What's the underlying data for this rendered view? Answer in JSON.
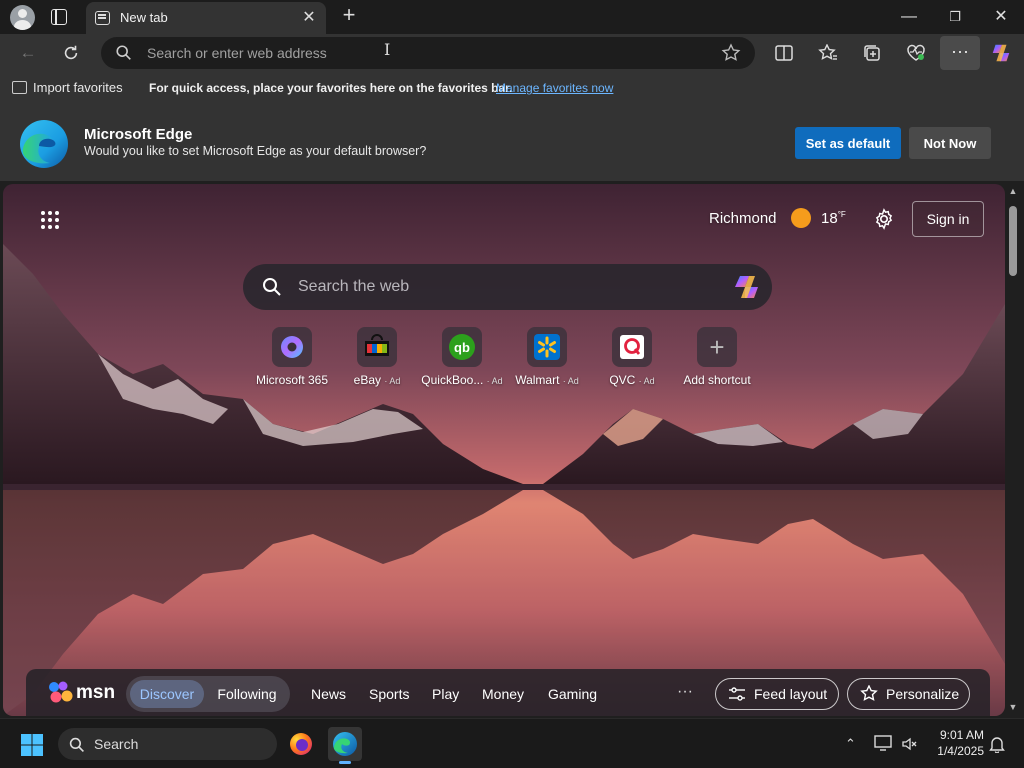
{
  "browser": {
    "tab": {
      "title": "New tab"
    },
    "window_controls": {
      "minimize": "—",
      "restore": "❐",
      "close": "✕"
    },
    "address_bar": {
      "placeholder": "Search or enter web address"
    },
    "more_label": "···"
  },
  "favorites_bar": {
    "import_label": "Import favorites",
    "message": "For quick access, place your favorites here on the favorites bar.",
    "manage_link": "Manage favorites now"
  },
  "default_prompt": {
    "title": "Microsoft Edge",
    "subtitle": "Would you like to set Microsoft Edge as your default browser?",
    "set_default_label": "Set as default",
    "not_now_label": "Not Now"
  },
  "newtab": {
    "weather": {
      "location": "Richmond",
      "temperature": "18",
      "unit": "°F"
    },
    "sign_in_label": "Sign in",
    "search": {
      "placeholder": "Search the web"
    },
    "shortcuts": [
      {
        "label": "Microsoft 365",
        "ad": ""
      },
      {
        "label": "eBay",
        "ad": "· Ad"
      },
      {
        "label": "QuickBoo...",
        "ad": "· Ad"
      },
      {
        "label": "Walmart",
        "ad": "· Ad"
      },
      {
        "label": "QVC",
        "ad": "· Ad"
      },
      {
        "label": "Add shortcut",
        "ad": ""
      }
    ]
  },
  "msn": {
    "logo_text": "msn",
    "pills": {
      "discover": "Discover",
      "following": "Following"
    },
    "nav": [
      "News",
      "Sports",
      "Play",
      "Money",
      "Gaming"
    ],
    "more": "···",
    "feed_layout_label": "Feed layout",
    "personalize_label": "Personalize"
  },
  "taskbar": {
    "search_label": "Search",
    "time": "9:01 AM",
    "date": "1/4/2025"
  },
  "colors": {
    "accent": "#0f6cbd",
    "link": "#6cb6ff",
    "discover": "#9cc6ff"
  }
}
